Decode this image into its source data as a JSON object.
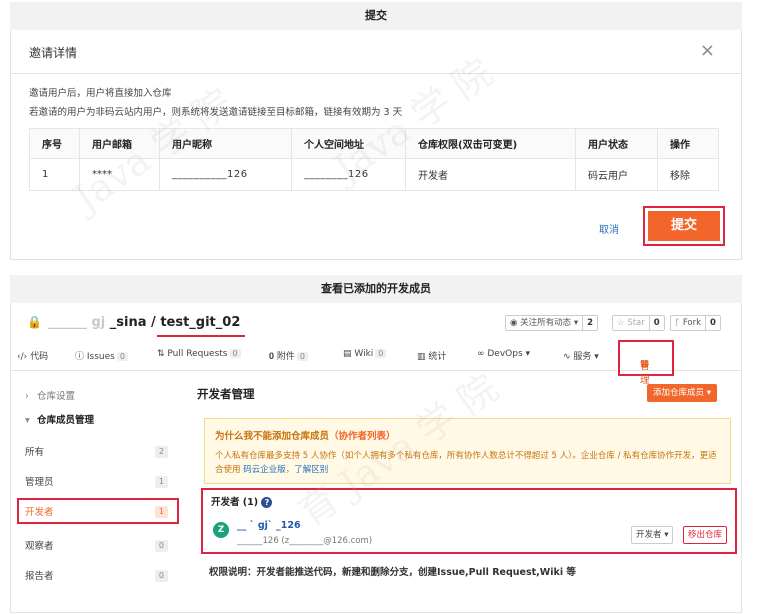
{
  "top_section_title": "提交",
  "invite": {
    "title": "邀请详情",
    "close_glyph": "×",
    "note1": "邀请用户后，用户将直接加入仓库",
    "note2": "若邀请的用户为非码云站内用户，则系统将发送邀请链接至目标邮箱，链接有效期为 3 天",
    "headers": [
      "序号",
      "用户邮箱",
      "用户昵称",
      "个人空间地址",
      "仓库权限(双击可变更)",
      "用户状态",
      "操作"
    ],
    "row": {
      "index": "1",
      "email": "****",
      "nickname": "__________126",
      "space": "________126",
      "permission": "开发者",
      "status": "码云用户",
      "action": "移除"
    },
    "cancel": "取消",
    "submit": "提交"
  },
  "bottom_section_title": "查看已添加的开发成员",
  "repo": {
    "owner_blurred": "______ gj ",
    "owner_suffix": "_sina / ",
    "name": "test_git_02",
    "watch_label": "关注所有动态",
    "watch_count": "2",
    "star_label": "Star",
    "star_count": "0",
    "fork_label": "Fork",
    "fork_count": "0"
  },
  "nav": {
    "code": "代码",
    "issues": "Issues",
    "issues_count": "0",
    "pr": "Pull Requests",
    "pr_count": "0",
    "attach": "附件",
    "attach_count": "0",
    "wiki": "Wiki",
    "wiki_count": "0",
    "stats": "统计",
    "devops": "DevOps ▾",
    "service": "服务 ▾",
    "manage": "管理"
  },
  "sidebar": {
    "settings": "仓库设置",
    "members": "仓库成员管理",
    "items": [
      {
        "label": "所有",
        "count": "2"
      },
      {
        "label": "管理员",
        "count": "1"
      },
      {
        "label": "开发者",
        "count": "1"
      },
      {
        "label": "观察者",
        "count": "0"
      },
      {
        "label": "报告者",
        "count": "0"
      }
    ]
  },
  "main": {
    "title": "开发者管理",
    "add_button": "添加仓库成员 ▾",
    "warn_title": "为什么我不能添加仓库成员",
    "warn_title_link": "（协作者列表）",
    "warn_body": "个人私有仓库最多支持 5 人协作（如个人拥有多个私有仓库，所有协作人数总计不得超过 5 人）。企业仓库 / 私有仓库协作开发，更适合使用 ",
    "warn_link1": "码云企业版",
    "warn_sep": "，",
    "warn_link2": "了解区别",
    "dev_title": "开发者 (1)",
    "dev_avatar": "Z",
    "dev_name": "__ ` gj` _126",
    "dev_sub": "______126 (z________@126.com)",
    "role": "开发者 ▾",
    "remove": "移出仓库",
    "perm": "权限说明：开发者能推送代码，新建和删除分支，创建Issue,Pull Request,Wiki 等"
  }
}
